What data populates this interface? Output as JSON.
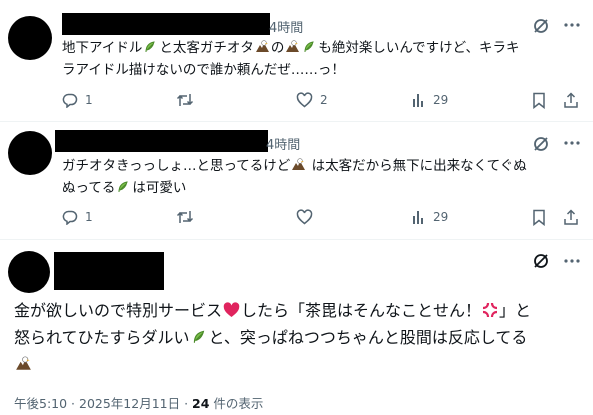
{
  "replies": [
    {
      "time": "4時間",
      "text_parts": [
        "地下アイドル",
        "と太客ガチオタ",
        "の",
        "",
        "も絶対楽しいんですけど、キラキ"
      ],
      "line2": "ラアイドル描けないので誰か頼んだぜ……っ！",
      "actions": {
        "reply_count": "1",
        "retweet_count": "",
        "like_count": "2",
        "view_count": "29"
      }
    },
    {
      "time": "4時間",
      "line1_parts": [
        "ガチオタきっっしょ…と思ってるけど",
        " は太客だから無下に出来なくてぐぬ"
      ],
      "line2_parts": [
        "ぬってる",
        "は可愛い"
      ],
      "actions": {
        "reply_count": "1",
        "retweet_count": "",
        "like_count": "",
        "view_count": "29"
      }
    }
  ],
  "main_post": {
    "line1_parts": [
      "金が欲しいので特別サービス",
      "したら「茶毘はそんなことせん！",
      "」と"
    ],
    "line2_parts": [
      "怒られてひたすらダルい",
      "と、突っぱねつつちゃんと股間は反応してる"
    ],
    "timestamp": "午後5:10 · 2025年12月11日 · ",
    "views_count": "24",
    "views_label": " 件の表示"
  },
  "icons": {
    "grok": "grok-icon",
    "more": "more-icon",
    "reply": "reply-icon",
    "retweet": "retweet-icon",
    "like": "like-icon",
    "views": "views-icon",
    "bookmark": "bookmark-icon",
    "share": "share-icon",
    "emoji_sprout": "sprout-emoji",
    "emoji_eagle": "eagle-emoji",
    "emoji_heart": "heart-emoji",
    "emoji_anger": "anger-emoji"
  },
  "colors": {
    "text": "#0f1419",
    "muted": "#536471",
    "heart": "#e0245e",
    "sprout": "#5fa83a"
  }
}
